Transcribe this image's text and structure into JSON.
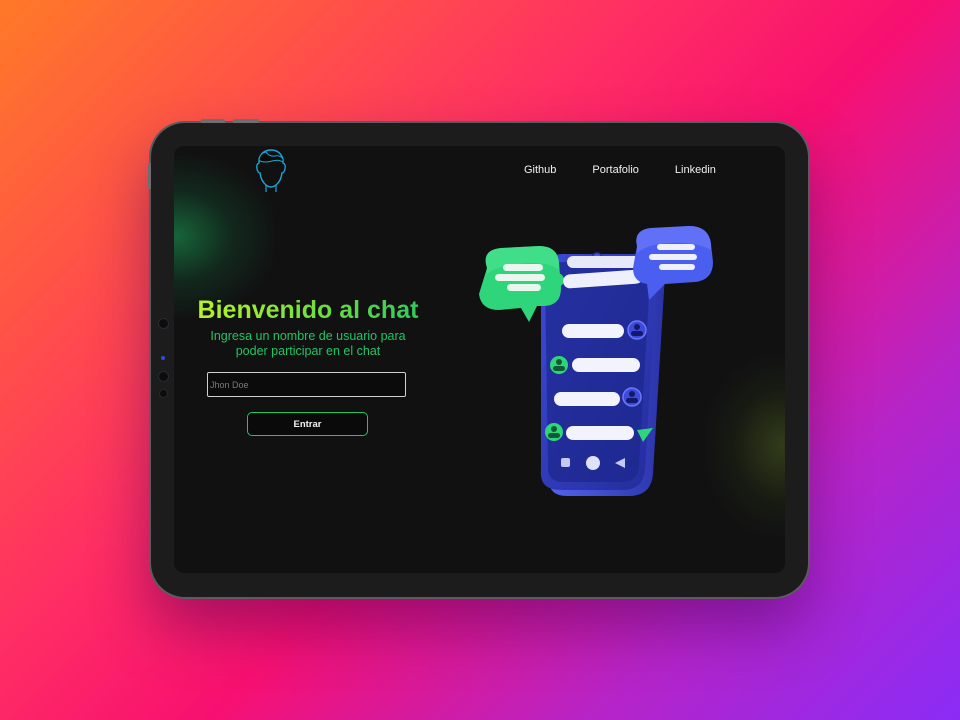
{
  "nav": {
    "links": [
      "Github",
      "Portafolio",
      "Linkedin"
    ]
  },
  "hero": {
    "title": "Bienvenido al chat",
    "subtitle": "Ingresa un nombre de usuario para poder participar en el chat"
  },
  "form": {
    "username_placeholder": "Jhon Doe",
    "submit_label": "Entrar"
  },
  "icons": {
    "logo": "user-face-outline-icon",
    "illustration": "chat-phone-illustration"
  },
  "colors": {
    "accent_green": "#1ec563",
    "title_gradient_start": "#c6f52a",
    "screen_background": "#111112",
    "phone_blue": "#3340c8",
    "bubble_green": "#2fd57a",
    "bubble_blue": "#4a5ef0"
  }
}
